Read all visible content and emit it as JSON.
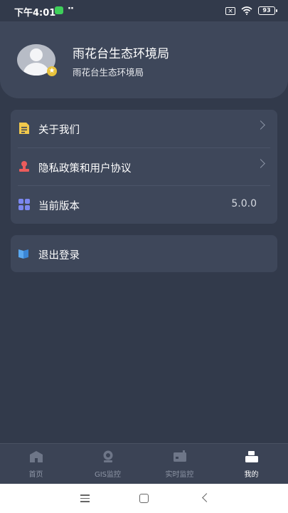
{
  "status_bar": {
    "time": "下午4:01",
    "dots": "··",
    "battery": "93",
    "sim_mark": "×"
  },
  "profile": {
    "title": "雨花台生态环境局",
    "subtitle": "雨花台生态环境局",
    "badge": "★"
  },
  "menu": {
    "items": [
      {
        "label": "关于我们",
        "icon": "document-icon",
        "color": "#f2c94c"
      },
      {
        "label": "隐私政策和用户协议",
        "icon": "stamp-icon",
        "color": "#eb5c5c"
      },
      {
        "label": "当前版本",
        "icon": "grid-icon",
        "color": "#7b87f0",
        "value": "5.0.0"
      }
    ]
  },
  "logout": {
    "label": "退出登录",
    "icon": "book-icon",
    "color": "#5aa8f0"
  },
  "tabbar": {
    "tabs": [
      {
        "label": "首页",
        "icon": "home-icon",
        "active": false
      },
      {
        "label": "GIS监控",
        "icon": "camera-icon",
        "active": false
      },
      {
        "label": "实时监控",
        "icon": "monitor-icon",
        "active": false
      },
      {
        "label": "我的",
        "icon": "profile-icon",
        "active": true
      }
    ]
  },
  "colors": {
    "background": "#323a4b",
    "card": "#3e475a",
    "tab_inactive": "#8e96a6",
    "tab_active": "#ffffff"
  }
}
